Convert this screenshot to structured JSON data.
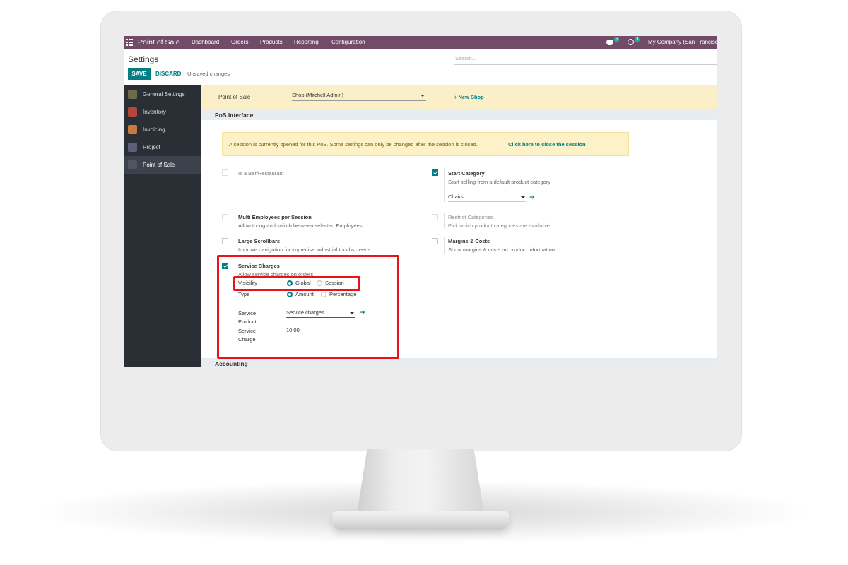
{
  "navbar": {
    "app_name": "Point of Sale",
    "menu": [
      "Dashboard",
      "Orders",
      "Products",
      "Reporting",
      "Configuration"
    ],
    "messages_count": "5",
    "activities_count": "3",
    "company": "My Company (San Francisco)"
  },
  "control_panel": {
    "title": "Settings",
    "search_placeholder": "Search...",
    "save_label": "SAVE",
    "discard_label": "DISCARD",
    "status": "Unsaved changes"
  },
  "sidebar": {
    "items": [
      {
        "label": "General Settings",
        "icon": "gear-icon",
        "color": "#6b6a4a"
      },
      {
        "label": "Inventory",
        "icon": "boxes-icon",
        "color": "#b5453c"
      },
      {
        "label": "Invoicing",
        "icon": "invoice-icon",
        "color": "#c67a3c"
      },
      {
        "label": "Project",
        "icon": "puzzle-icon",
        "color": "#5c5f7a"
      },
      {
        "label": "Point of Sale",
        "icon": "store-icon",
        "color": "#4e5560"
      }
    ]
  },
  "shop_bar": {
    "label": "Point of Sale",
    "selected_shop": "Shop (Mitchell Admin)",
    "new_shop": "+ New Shop"
  },
  "sections": {
    "pos_interface": "PoS Interface",
    "accounting": "Accounting"
  },
  "warning": {
    "message": "A session is currently opened for this PoS. Some settings can only be changed after the session is closed.",
    "link": "Click here to close the session"
  },
  "settings": {
    "bar_restaurant": {
      "title": "Is a Bar/Restaurant",
      "checked": false
    },
    "start_category": {
      "title": "Start Category",
      "desc": "Start selling from a default product category",
      "checked": true,
      "value": "Chairs"
    },
    "multi_employees": {
      "title": "Multi Employees per Session",
      "desc": "Allow to log and switch between selected Employees",
      "checked": false
    },
    "restrict_categories": {
      "title": "Restrict Categories",
      "desc": "Pick which product categories are available",
      "checked": false
    },
    "large_scrollbars": {
      "title": "Large Scrollbars",
      "desc": "Improve navigation for imprecise industrial touchscreens",
      "checked": false
    },
    "margins_costs": {
      "title": "Margins & Costs",
      "desc": "Show margins & costs on product information",
      "checked": false
    },
    "service_charges": {
      "title": "Service Charges",
      "desc": "Allow service charges on orders",
      "checked": true,
      "visibility_label": "Visibility",
      "visibility_options": [
        "Global",
        "Session"
      ],
      "visibility_selected": "Global",
      "type_label": "Type",
      "type_options": [
        "Amount",
        "Percentage"
      ],
      "type_selected": "Amount",
      "product_label_1": "Service",
      "product_label_2": "Product",
      "product_value": "Service charges",
      "charge_label_1": "Service",
      "charge_label_2": "Charge",
      "charge_value": "10.00"
    }
  },
  "colors": {
    "brand": "#714b67",
    "accent": "#017e84",
    "highlight": "#e8141a"
  }
}
